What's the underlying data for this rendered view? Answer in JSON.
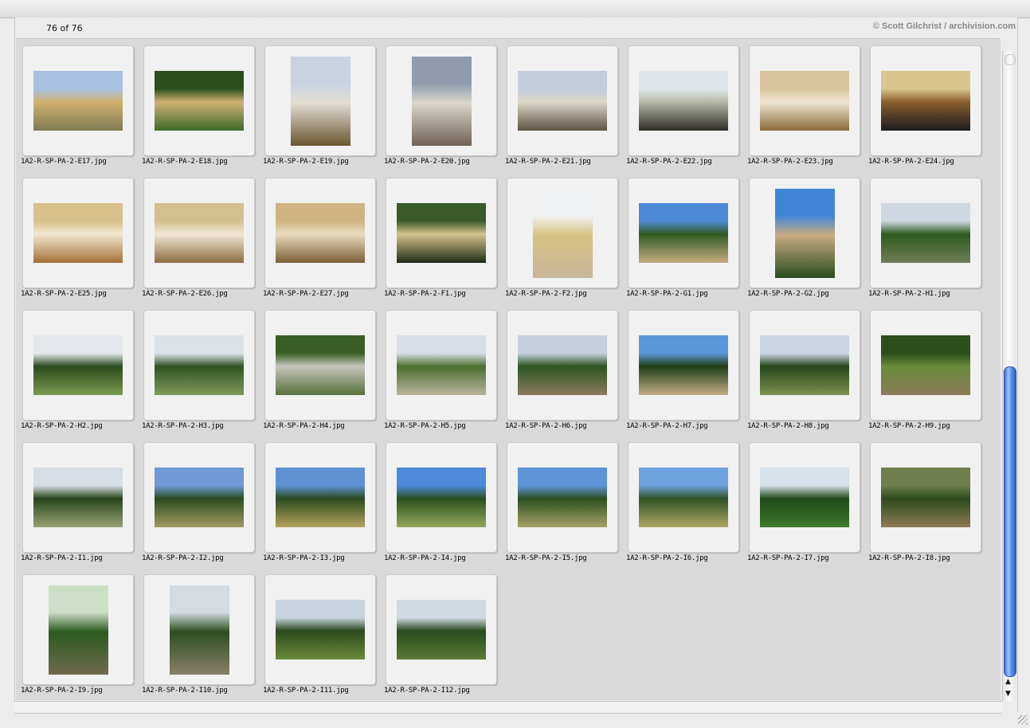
{
  "window": {
    "count_label": "76 of 76",
    "copyright": "© Scott Gilchrist / archivision.com"
  },
  "thumbnails": [
    {
      "file": "1A2-R-SP-PA-2-E17.jpg",
      "orientation": "landscape",
      "palette": [
        "#a9c1e0",
        "#d1b16f",
        "#7f7a55"
      ]
    },
    {
      "file": "1A2-R-SP-PA-2-E18.jpg",
      "orientation": "landscape",
      "palette": [
        "#2c4d1e",
        "#cfb173",
        "#3f6a2a"
      ]
    },
    {
      "file": "1A2-R-SP-PA-2-E19.jpg",
      "orientation": "portrait",
      "palette": [
        "#c9d3e0",
        "#e2ddd3",
        "#6a5530"
      ]
    },
    {
      "file": "1A2-R-SP-PA-2-E20.jpg",
      "orientation": "portrait",
      "palette": [
        "#8e9cae",
        "#dad6cc",
        "#6f6354"
      ]
    },
    {
      "file": "1A2-R-SP-PA-2-E21.jpg",
      "orientation": "landscape",
      "palette": [
        "#c3cddb",
        "#dcd7ca",
        "#5e5242"
      ]
    },
    {
      "file": "1A2-R-SP-PA-2-E22.jpg",
      "orientation": "landscape",
      "palette": [
        "#dfe6ea",
        "#b6b8a8",
        "#2d2b26"
      ]
    },
    {
      "file": "1A2-R-SP-PA-2-E23.jpg",
      "orientation": "landscape",
      "palette": [
        "#d9c49b",
        "#efe6d2",
        "#8a6a3a"
      ]
    },
    {
      "file": "1A2-R-SP-PA-2-E24.jpg",
      "orientation": "landscape",
      "palette": [
        "#dbc58f",
        "#8a5f2d",
        "#1b1b22"
      ]
    },
    {
      "file": "1A2-R-SP-PA-2-E25.jpg",
      "orientation": "landscape",
      "palette": [
        "#d8c08a",
        "#f1e8d2",
        "#a26f36"
      ]
    },
    {
      "file": "1A2-R-SP-PA-2-E26.jpg",
      "orientation": "landscape",
      "palette": [
        "#d4bf8e",
        "#efe7d5",
        "#8d6c42"
      ]
    },
    {
      "file": "1A2-R-SP-PA-2-E27.jpg",
      "orientation": "landscape",
      "palette": [
        "#cfb481",
        "#e8dcc0",
        "#7c5d36"
      ]
    },
    {
      "file": "1A2-R-SP-PA-2-F1.jpg",
      "orientation": "landscape",
      "palette": [
        "#3b5a29",
        "#d6c38e",
        "#1e2c16"
      ]
    },
    {
      "file": "1A2-R-SP-PA-2-F2.jpg",
      "orientation": "portrait",
      "palette": [
        "#f0f2f3",
        "#d9c283",
        "#c7b69a"
      ]
    },
    {
      "file": "1A2-R-SP-PA-2-G1.jpg",
      "orientation": "landscape",
      "palette": [
        "#4d8ad6",
        "#2f5a22",
        "#c7ab7e"
      ]
    },
    {
      "file": "1A2-R-SP-PA-2-G2.jpg",
      "orientation": "portrait",
      "palette": [
        "#3f86d8",
        "#c9ab80",
        "#2a4c1f"
      ]
    },
    {
      "file": "1A2-R-SP-PA-2-H1.jpg",
      "orientation": "landscape",
      "palette": [
        "#cfd8e0",
        "#2d5c1f",
        "#6f7c57"
      ]
    },
    {
      "file": "1A2-R-SP-PA-2-H2.jpg",
      "orientation": "landscape",
      "palette": [
        "#e4e8ec",
        "#2a4b1d",
        "#7a9a4f"
      ]
    },
    {
      "file": "1A2-R-SP-PA-2-H3.jpg",
      "orientation": "landscape",
      "palette": [
        "#dce2e8",
        "#2f5323",
        "#7f9a58"
      ]
    },
    {
      "file": "1A2-R-SP-PA-2-H4.jpg",
      "orientation": "landscape",
      "palette": [
        "#3a5f26",
        "#c7c5bb",
        "#56703b"
      ]
    },
    {
      "file": "1A2-R-SP-PA-2-H5.jpg",
      "orientation": "landscape",
      "palette": [
        "#d8dee5",
        "#4c6f30",
        "#b7b39c"
      ]
    },
    {
      "file": "1A2-R-SP-PA-2-H6.jpg",
      "orientation": "landscape",
      "palette": [
        "#c4cfdc",
        "#2e5521",
        "#8b7a5f"
      ]
    },
    {
      "file": "1A2-R-SP-PA-2-H7.jpg",
      "orientation": "landscape",
      "palette": [
        "#5b98d9",
        "#1f3d17",
        "#c1ad86"
      ]
    },
    {
      "file": "1A2-R-SP-PA-2-H8.jpg",
      "orientation": "landscape",
      "palette": [
        "#cbd6e3",
        "#25451a",
        "#7d9150"
      ]
    },
    {
      "file": "1A2-R-SP-PA-2-H9.jpg",
      "orientation": "landscape",
      "palette": [
        "#2b4e1c",
        "#6a8c3b",
        "#8a7b5a"
      ]
    },
    {
      "file": "1A2-R-SP-PA-2-I1.jpg",
      "orientation": "landscape",
      "palette": [
        "#d6dde4",
        "#26461b",
        "#9aa274"
      ]
    },
    {
      "file": "1A2-R-SP-PA-2-I2.jpg",
      "orientation": "landscape",
      "palette": [
        "#6e9bd6",
        "#2a4b20",
        "#a39a64"
      ]
    },
    {
      "file": "1A2-R-SP-PA-2-I3.jpg",
      "orientation": "landscape",
      "palette": [
        "#5f90d4",
        "#2b4b1f",
        "#b4a35e"
      ]
    },
    {
      "file": "1A2-R-SP-PA-2-I4.jpg",
      "orientation": "landscape",
      "palette": [
        "#4b8bd9",
        "#2a4f1f",
        "#94a85a"
      ]
    },
    {
      "file": "1A2-R-SP-PA-2-I5.jpg",
      "orientation": "landscape",
      "palette": [
        "#5f94d8",
        "#2b4f20",
        "#a7a267"
      ]
    },
    {
      "file": "1A2-R-SP-PA-2-I6.jpg",
      "orientation": "landscape",
      "palette": [
        "#6ea3df",
        "#2e5224",
        "#b0a763"
      ]
    },
    {
      "file": "1A2-R-SP-PA-2-I7.jpg",
      "orientation": "landscape",
      "palette": [
        "#d6e0e8",
        "#1f4a1a",
        "#3d7a2a"
      ]
    },
    {
      "file": "1A2-R-SP-PA-2-I8.jpg",
      "orientation": "landscape",
      "palette": [
        "#6f7e4c",
        "#2d4b1e",
        "#8c7a55"
      ]
    },
    {
      "file": "1A2-R-SP-PA-2-I9.jpg",
      "orientation": "portrait",
      "palette": [
        "#cde0c7",
        "#2c5b20",
        "#6f6a4e"
      ]
    },
    {
      "file": "1A2-R-SP-PA-2-I10.jpg",
      "orientation": "portrait",
      "palette": [
        "#d4dbe1",
        "#2e4f22",
        "#8a7f6a"
      ]
    },
    {
      "file": "1A2-R-SP-PA-2-I11.jpg",
      "orientation": "landscape",
      "palette": [
        "#c9d4de",
        "#2a4a1e",
        "#6b8a3a"
      ]
    },
    {
      "file": "1A2-R-SP-PA-2-I12.jpg",
      "orientation": "landscape",
      "palette": [
        "#d0d8e0",
        "#284c1e",
        "#5a7b34"
      ]
    }
  ]
}
